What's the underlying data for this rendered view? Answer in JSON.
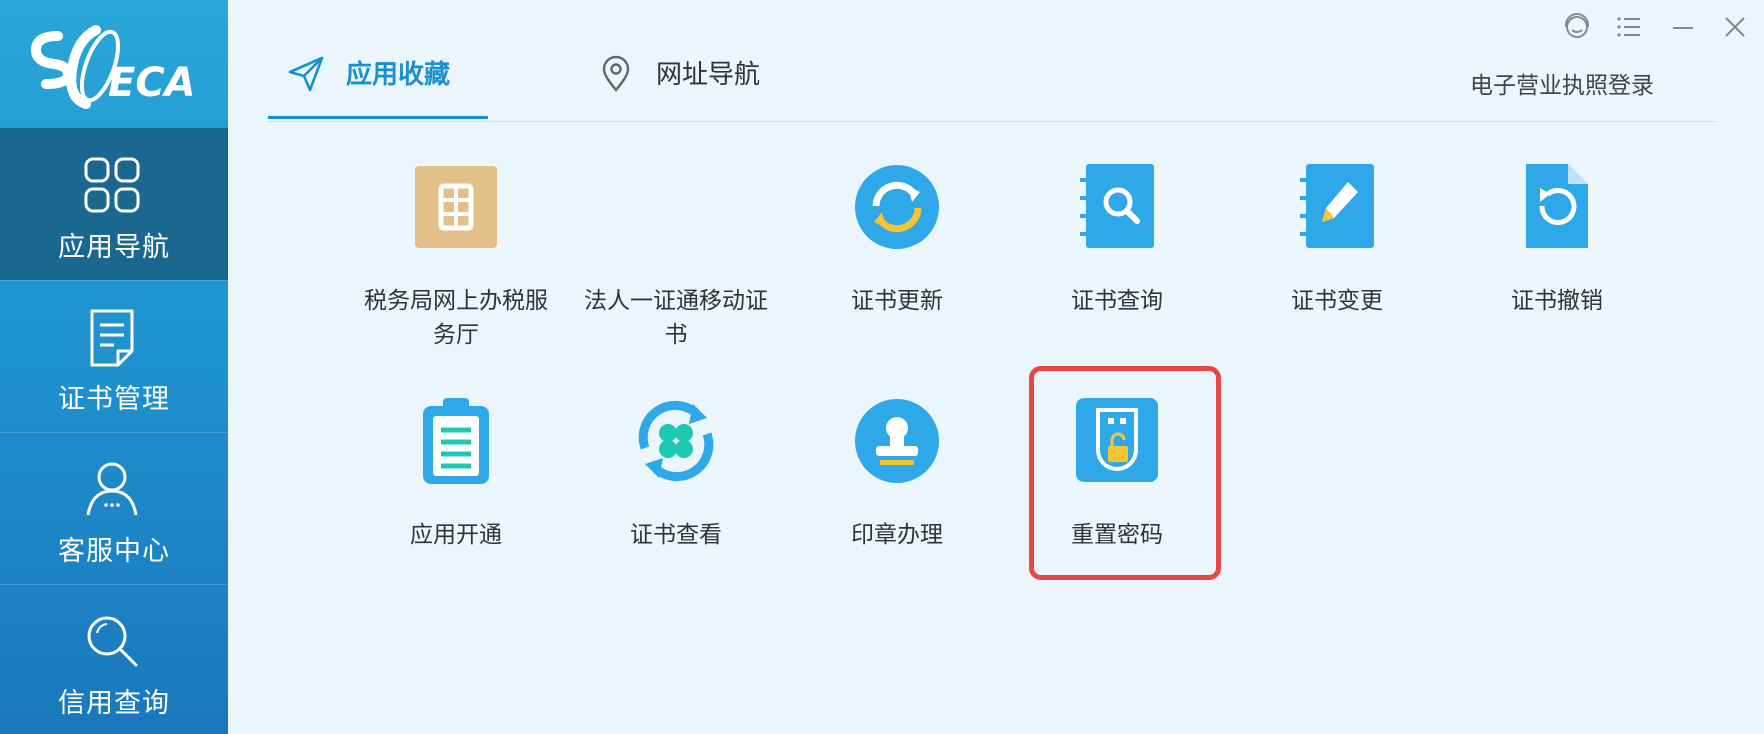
{
  "sidebar": {
    "logo_text": "ECA",
    "items": [
      {
        "label": "应用导航",
        "icon": "grid-icon"
      },
      {
        "label": "证书管理",
        "icon": "document-icon"
      },
      {
        "label": "客服中心",
        "icon": "user-icon"
      },
      {
        "label": "信用查询",
        "icon": "search-icon"
      }
    ]
  },
  "tabs": [
    {
      "label": "应用收藏",
      "icon": "paper-plane-icon"
    },
    {
      "label": "网址导航",
      "icon": "location-pin-icon"
    }
  ],
  "header": {
    "biz_login": "电子营业执照登录"
  },
  "window_controls": [
    "support-icon",
    "menu-icon",
    "minimize-icon",
    "close-icon"
  ],
  "apps": [
    {
      "label": "税务局网上办税服务厅",
      "icon": "tax-icon"
    },
    {
      "label": "法人一证通移动证书",
      "icon": "blank-icon"
    },
    {
      "label": "证书更新",
      "icon": "refresh-icon"
    },
    {
      "label": "证书查询",
      "icon": "notebook-search-icon"
    },
    {
      "label": "证书变更",
      "icon": "notebook-edit-icon"
    },
    {
      "label": "证书撤销",
      "icon": "file-undo-icon"
    },
    {
      "label": "应用开通",
      "icon": "clipboard-icon"
    },
    {
      "label": "证书查看",
      "icon": "clover-sync-icon"
    },
    {
      "label": "印章办理",
      "icon": "stamp-icon"
    },
    {
      "label": "重置密码",
      "icon": "usb-lock-icon"
    }
  ],
  "colors": {
    "accent": "#1c8fd0",
    "icon_blue": "#2ea8e8",
    "tax_gold": "#e3c08a",
    "highlight": "#e84646",
    "sidebar_active": "#1a6790"
  }
}
